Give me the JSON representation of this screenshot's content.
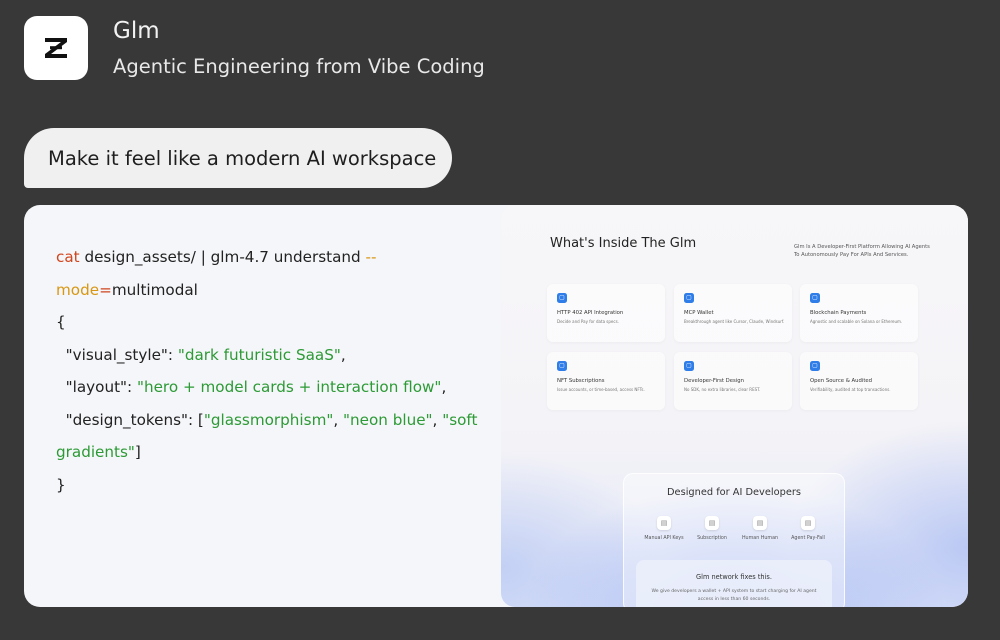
{
  "header": {
    "icon": "z-logo-icon",
    "title": "Glm",
    "subtitle": "Agentic Engineering from Vibe Coding"
  },
  "prompt": {
    "text": "Make it feel like a modern AI workspace"
  },
  "code": {
    "line1_cmd": "cat",
    "line1_rest": " design_assets/ | glm-4.7 understand ",
    "line1_flag": "--",
    "line2_flag": "mode",
    "line2_eq": "=",
    "line2_value": "multimodal",
    "open_brace": "{",
    "visual_style_key": "  \"visual_style\": ",
    "visual_style_value": "\"dark futuristic SaaS\"",
    "layout_key": "  \"layout\": ",
    "layout_value": "\"hero + model cards + interaction flow\"",
    "tokens_key": "  \"design_tokens\": [",
    "token1": "\"glassmorphism\"",
    "token2": "\"neon blue\"",
    "token3_part1": "\"soft",
    "token3_part2": "gradients\"",
    "close_bracket": "]",
    "close_brace": "}",
    "comma": ",",
    "sep": ", "
  },
  "preview": {
    "title": "What's Inside The Glm",
    "tagline": "Glm Is A Developer-First Platform Allowing AI Agents To Autonomously Pay For APIs And Services.",
    "features": [
      {
        "title": "HTTP 402 API Integration",
        "desc": "Decide and Pay for data specs."
      },
      {
        "title": "MCP Wallet",
        "desc": "Breakthrough agent like Cursor, Claude, Windsurf."
      },
      {
        "title": "Blockchain Payments",
        "desc": "Agnostic and scalable on Solana or Ethereum."
      },
      {
        "title": "NFT Subscriptions",
        "desc": "Issue accounts, or time-based, access NFTs."
      },
      {
        "title": "Developer-First Design",
        "desc": "No SDK, no extra libraries, clear REST."
      },
      {
        "title": "Open Source & Audited",
        "desc": "Verifiability, audited at top transactions."
      }
    ],
    "dev_panel": {
      "title": "Designed for AI Developers",
      "items": [
        {
          "label": "Manual API Keys"
        },
        {
          "label": "Subscription"
        },
        {
          "label": "Human Human"
        },
        {
          "label": "Agent Pay-Fall"
        }
      ],
      "fix_title": "Glm network fixes this.",
      "fix_desc": "We give developers a wallet + API system to start charging for AI agent access in less than 60 seconds."
    }
  },
  "colors": {
    "background": "#383838",
    "card": "#f5f6f9",
    "keyword": "#d0461f",
    "flag": "#d79712",
    "string": "#2c9a35",
    "accent": "#2f7de8"
  }
}
